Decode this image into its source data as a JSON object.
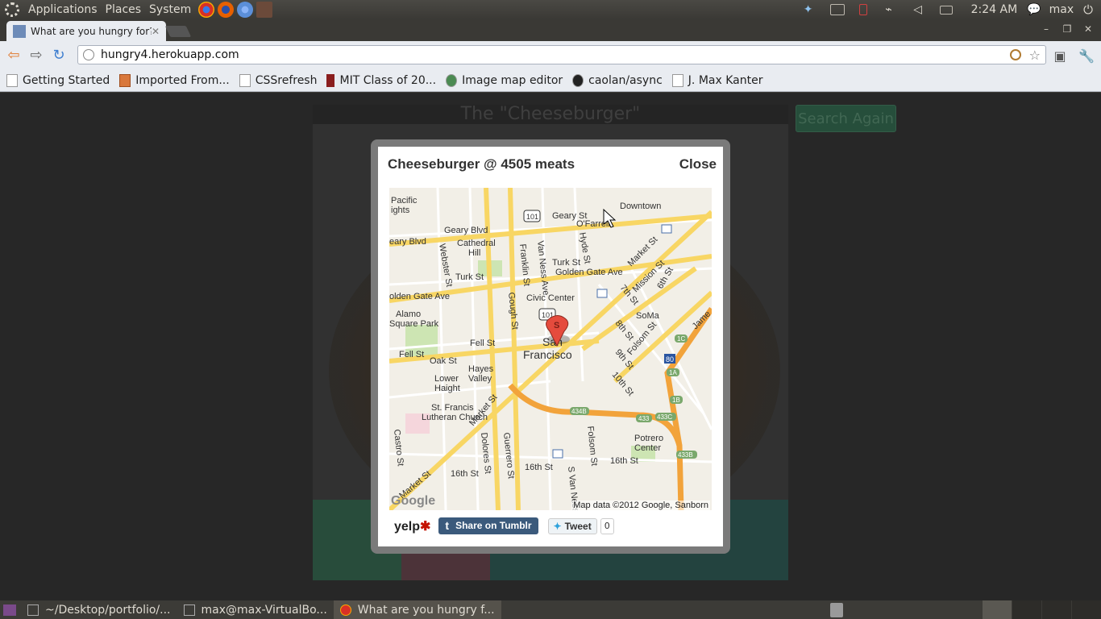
{
  "top_panel": {
    "menus": [
      "Applications",
      "Places",
      "System"
    ],
    "launchers": [
      "chrome-icon",
      "firefox-icon",
      "chromium-icon",
      "terminal-icon"
    ],
    "clock": "2:24 AM",
    "user": "max"
  },
  "browser": {
    "tab_title": "What are you hungry for?",
    "url": "hungry4.herokuapp.com",
    "bookmarks": [
      "Getting Started",
      "Imported From...",
      "CSSrefresh",
      "MIT Class of 20...",
      "Image map editor",
      "caolan/async",
      "J. Max Kanter"
    ]
  },
  "page": {
    "card_title": "The \"Cheeseburger\"",
    "search_again": "Search Again"
  },
  "modal": {
    "title": "Cheeseburger @ 4505 meats",
    "close": "Close",
    "map": {
      "labels": {
        "pacific": "Pacific",
        "ights": "ights",
        "downtown": "Downtown",
        "geary_st": "Geary St",
        "ofarrell": "O'Farrell",
        "geary_blvd": "Geary Blvd",
        "geary_blvd2": "eary Blvd",
        "cathedral": "Cathedral",
        "hill": "Hill",
        "webster": "Webster St",
        "franklin": "Franklin St",
        "van_ness": "Van Ness Ave",
        "hyde": "Hyde St",
        "market": "Market St",
        "turk": "Turk St",
        "turk2": "Turk St",
        "golden_gate": "Golden Gate Ave",
        "golden_gate2": "olden Gate Ave",
        "mission": "Mission St",
        "civic_center": "Civic Center",
        "seventh": "7th St",
        "sixth": "6th St",
        "gough": "Gough St",
        "soma": "SoMa",
        "alamo": "Alamo",
        "square_park": "Square Park",
        "eighth": "8th St",
        "folsom": "Folsom St",
        "fell": "Fell St",
        "oak": "Oak St",
        "san": "San",
        "francisco": "Francisco",
        "hayes": "Hayes",
        "valley": "Valley",
        "lower": "Lower",
        "haight": "Haight",
        "ninth": "9th St",
        "tenth": "10th St",
        "st_francis": "St. Francis",
        "lutheran": "Lutheran Church",
        "castro": "Castro St",
        "market2": "Market St",
        "dolores": "Dolores St",
        "guerrero": "Guerrero St",
        "folsom2": "Folsom St",
        "potrero": "Potrero",
        "center": "Center",
        "sixteenth": "16th St",
        "sixteenth2": "16th St",
        "sixteenth3": "16th St",
        "s_van_ness": "S Van Ness",
        "james": "Jame",
        "hwy101": "101",
        "hwy101b": "101",
        "i80": "80",
        "exit434b": "434B",
        "exit433": "433",
        "exit433c": "433C",
        "exit433b": "433B",
        "exit1c": "1C",
        "exit1a": "1A",
        "exit1b": "1B"
      },
      "pin_letter": "S",
      "logo": "Google",
      "attribution": "Map data ©2012 Google, Sanborn"
    },
    "yelp": "yelp",
    "tumblr": "Share on Tumblr",
    "tweet": "Tweet",
    "tweet_count": "0"
  },
  "bottom_panel": {
    "tasks": [
      "~/Desktop/portfolio/...",
      "max@max-VirtualBo...",
      "What are you hungry f..."
    ]
  },
  "colors": {
    "map_road_major": "#f8d664",
    "map_road_minor": "#ffffff",
    "freeway": "#f2a33b",
    "park": "#cde5b3",
    "pin": "#e54b3d"
  }
}
